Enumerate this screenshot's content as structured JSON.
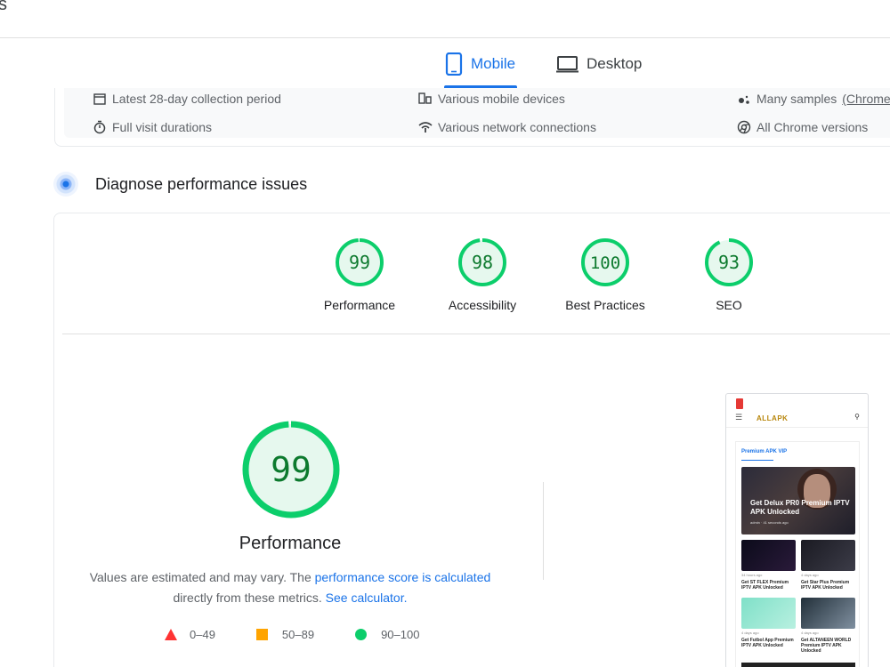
{
  "header": {
    "crumb": "s"
  },
  "device_tabs": [
    {
      "label": "Mobile",
      "icon": "smartphone-icon",
      "selected": true
    },
    {
      "label": "Desktop",
      "icon": "laptop-icon",
      "selected": false
    }
  ],
  "field_data": {
    "row1": [
      {
        "icon": "calendar-icon",
        "label": "Latest 28-day collection period"
      },
      {
        "icon": "devices-icon",
        "label": "Various mobile devices"
      },
      {
        "icon": "samples-icon",
        "label": "Many samples",
        "link": "(Chrome U"
      }
    ],
    "row2": [
      {
        "icon": "stopwatch-icon",
        "label": "Full visit durations"
      },
      {
        "icon": "network-icon",
        "label": "Various network connections"
      },
      {
        "icon": "chrome-icon",
        "label": "All Chrome versions"
      }
    ]
  },
  "diagnose": {
    "title": "Diagnose performance issues"
  },
  "scores": [
    {
      "value": 99,
      "label": "Performance"
    },
    {
      "value": 98,
      "label": "Accessibility"
    },
    {
      "value": 100,
      "label": "Best Practices"
    },
    {
      "value": 93,
      "label": "SEO"
    }
  ],
  "performance": {
    "score": 99,
    "label": "Performance",
    "desc_prefix": "Values are estimated and may vary. The ",
    "desc_link1": "performance score is calculated",
    "desc_middle": "directly from these metrics. ",
    "desc_link2": "See calculator."
  },
  "legend": [
    {
      "shape": "triangle",
      "range": "0–49",
      "color": "#ff3333"
    },
    {
      "shape": "square",
      "range": "50–89",
      "color": "#ffa400"
    },
    {
      "shape": "circle",
      "range": "90–100",
      "color": "#0cce6b"
    }
  ],
  "screenshot": {
    "logo": "ALLAPK",
    "section": "Premium APK VIP",
    "hero_title": "Get Delux PR0 Premium IPTV APK Unlocked",
    "hero_meta": "admin  ·  41 seconds ago",
    "items": [
      {
        "meta": "34 hours ago",
        "title": "Get ST FLEX Premium IPTV APK Unlocked"
      },
      {
        "meta": "4 days ago",
        "title": "Get Star Plus Premium IPTV APK Unlocked"
      },
      {
        "meta": "4 days ago",
        "title": "Get Futbol App Premium IPTV APK Unlocked"
      },
      {
        "meta": "4 days ago",
        "title": "Get ALTANEEN WORLD Premium IPTV APK Unlocked"
      }
    ]
  },
  "colors": {
    "accent": "#1a73e8",
    "pass": "#0cce6b",
    "pass_text": "#0d7a2e",
    "pass_bg": "#e6f8ee"
  }
}
